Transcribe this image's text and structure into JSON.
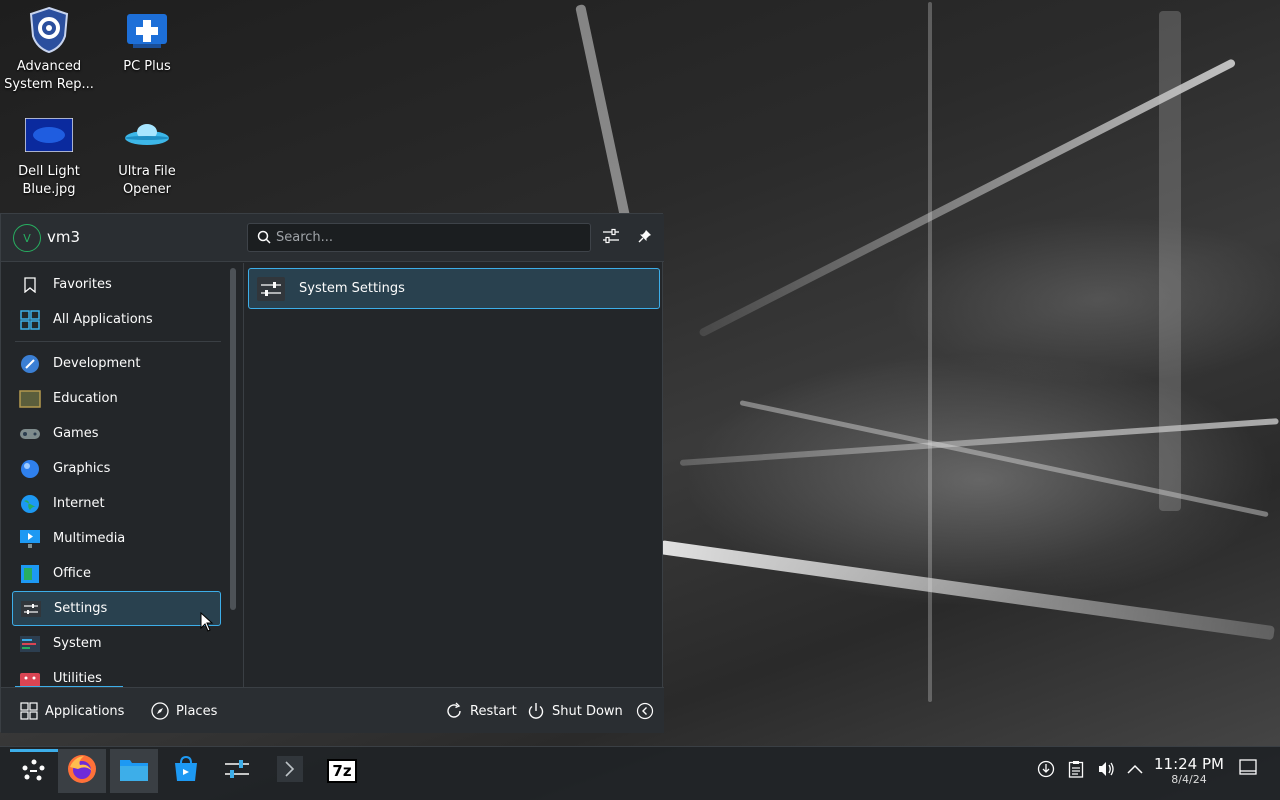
{
  "desktop": {
    "icons": [
      {
        "label": "Advanced System Rep...",
        "icon": "shield-gear-icon"
      },
      {
        "label": "PC Plus",
        "icon": "medical-plus-icon"
      },
      {
        "label": "Dell Light Blue.jpg",
        "icon": "image-file-icon"
      },
      {
        "label": "Ultra File Opener",
        "icon": "ufo-icon"
      }
    ]
  },
  "launcher": {
    "user": {
      "avatar_initial": "V",
      "name": "vm3"
    },
    "search": {
      "placeholder": "Search..."
    },
    "categories": [
      {
        "label": "Favorites",
        "icon": "bookmark-icon"
      },
      {
        "label": "All Applications",
        "icon": "grid-icon"
      },
      {
        "label": "Development",
        "icon": "development-icon"
      },
      {
        "label": "Education",
        "icon": "education-icon"
      },
      {
        "label": "Games",
        "icon": "gamepad-icon"
      },
      {
        "label": "Graphics",
        "icon": "graphics-icon"
      },
      {
        "label": "Internet",
        "icon": "globe-icon"
      },
      {
        "label": "Multimedia",
        "icon": "multimedia-icon"
      },
      {
        "label": "Office",
        "icon": "office-icon"
      },
      {
        "label": "Settings",
        "icon": "settings-sliders-icon"
      },
      {
        "label": "System",
        "icon": "system-icon"
      },
      {
        "label": "Utilities",
        "icon": "utilities-icon"
      }
    ],
    "active_category": "Settings",
    "results": [
      {
        "label": "System Settings",
        "icon": "system-settings-icon"
      }
    ],
    "footer": {
      "applications": "Applications",
      "places": "Places",
      "restart": "Restart",
      "shutdown": "Shut Down"
    }
  },
  "taskbar": {
    "apps": [
      "application-launcher",
      "firefox",
      "file-manager",
      "discover-store",
      "system-settings",
      "terminal",
      "7zip"
    ],
    "sevenzip_label": "7z",
    "clock": {
      "time": "11:24 PM",
      "date": "8/4/24"
    }
  },
  "colors": {
    "accent": "#3daee9",
    "panel_bg": "#232629",
    "selection_bg": "#29414f"
  }
}
